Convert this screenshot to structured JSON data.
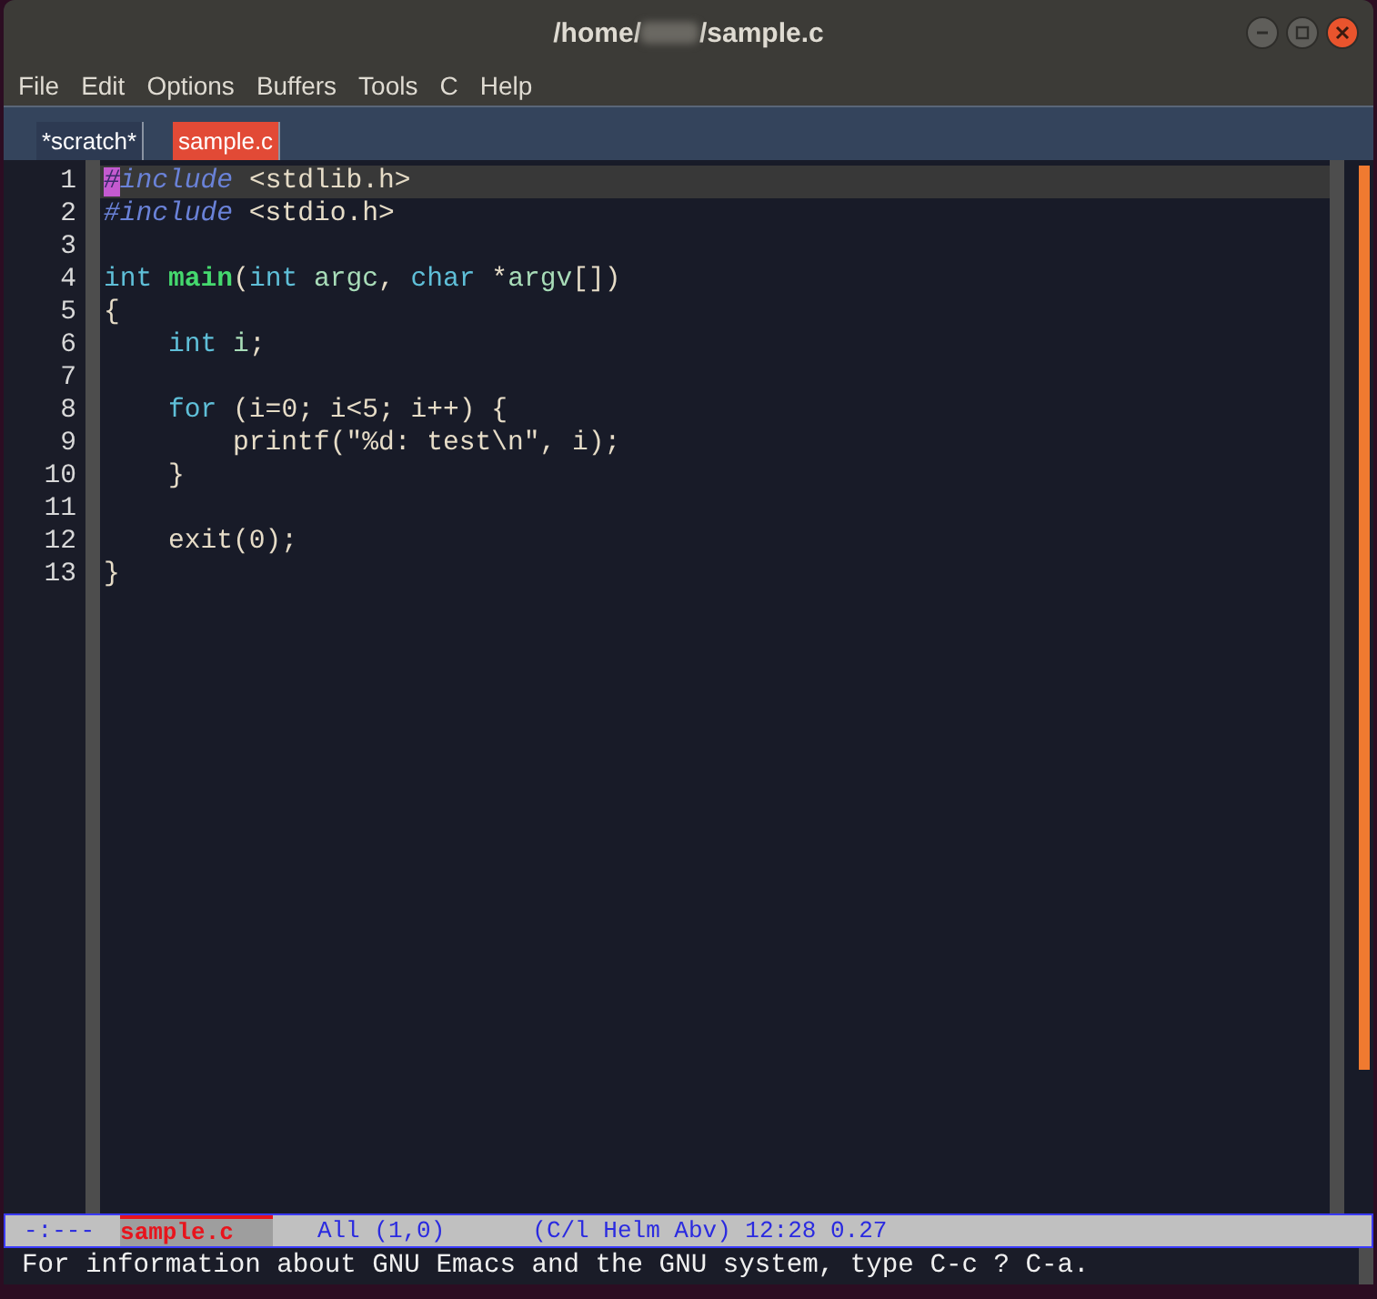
{
  "window": {
    "title_prefix": "/home/",
    "title_suffix": "/sample.c"
  },
  "menu": [
    "File",
    "Edit",
    "Options",
    "Buffers",
    "Tools",
    "C",
    "Help"
  ],
  "tabs": [
    {
      "label": "*scratch*",
      "selected": false
    },
    {
      "label": "sample.c",
      "selected": true
    }
  ],
  "editor": {
    "lines": [
      {
        "number": "1",
        "current": true,
        "tokens": [
          {
            "text": "#",
            "kind": "preproc",
            "cursor": true
          },
          {
            "text": "include",
            "kind": "preproc",
            "cursor": false
          },
          {
            "text": " <stdlib.h>",
            "kind": "plain",
            "cursor": false
          }
        ]
      },
      {
        "number": "2",
        "current": false,
        "tokens": [
          {
            "text": "#include",
            "kind": "preproc",
            "cursor": false
          },
          {
            "text": " <stdio.h>",
            "kind": "plain",
            "cursor": false
          }
        ]
      },
      {
        "number": "3",
        "current": false
      },
      {
        "number": "4",
        "current": false,
        "tokens": [
          {
            "text": "int ",
            "kind": "keyword",
            "cursor": false
          },
          {
            "text": "main",
            "kind": "function",
            "cursor": false
          },
          {
            "text": "(",
            "kind": "plain",
            "cursor": false
          },
          {
            "text": "int",
            "kind": "keyword",
            "cursor": false
          },
          {
            "text": " argc",
            "kind": "variable",
            "cursor": false
          },
          {
            "text": ", ",
            "kind": "plain",
            "cursor": false
          },
          {
            "text": "char",
            "kind": "keyword",
            "cursor": false
          },
          {
            "text": " *",
            "kind": "plain",
            "cursor": false
          },
          {
            "text": "argv",
            "kind": "variable",
            "cursor": false
          },
          {
            "text": "[])",
            "kind": "plain",
            "cursor": false
          }
        ]
      },
      {
        "number": "5",
        "current": false,
        "tokens": [
          {
            "text": "{",
            "kind": "plain",
            "cursor": false
          }
        ]
      },
      {
        "number": "6",
        "current": false,
        "tokens": [
          {
            "text": "    int",
            "kind": "keyword",
            "cursor": false
          },
          {
            "text": " i",
            "kind": "variable",
            "cursor": false
          },
          {
            "text": ";",
            "kind": "plain",
            "cursor": false
          }
        ]
      },
      {
        "number": "7",
        "current": false
      },
      {
        "number": "8",
        "current": false,
        "tokens": [
          {
            "text": "    for",
            "kind": "keyword",
            "cursor": false
          },
          {
            "text": " (i=0; i<5; i++) {",
            "kind": "plain",
            "cursor": false
          }
        ]
      },
      {
        "number": "9",
        "current": false,
        "tokens": [
          {
            "text": "        printf(\"%d: test\\n\", i);",
            "kind": "plain",
            "cursor": false
          }
        ]
      },
      {
        "number": "10",
        "current": false,
        "tokens": [
          {
            "text": "    }",
            "kind": "plain",
            "cursor": false
          }
        ]
      },
      {
        "number": "11",
        "current": false
      },
      {
        "number": "12",
        "current": false,
        "tokens": [
          {
            "text": "    exit(0);",
            "kind": "plain",
            "cursor": false
          }
        ]
      },
      {
        "number": "13",
        "current": false,
        "tokens": [
          {
            "text": "}",
            "kind": "plain",
            "cursor": false
          }
        ]
      }
    ]
  },
  "mode_line": {
    "status": "-:---",
    "buffer": "sample.c",
    "position": "All (1,0)",
    "modes": "(C/l Helm Abv) 12:28 0.27"
  },
  "echo_area": "For information about GNU Emacs and the GNU system, type C-c ? C-a."
}
